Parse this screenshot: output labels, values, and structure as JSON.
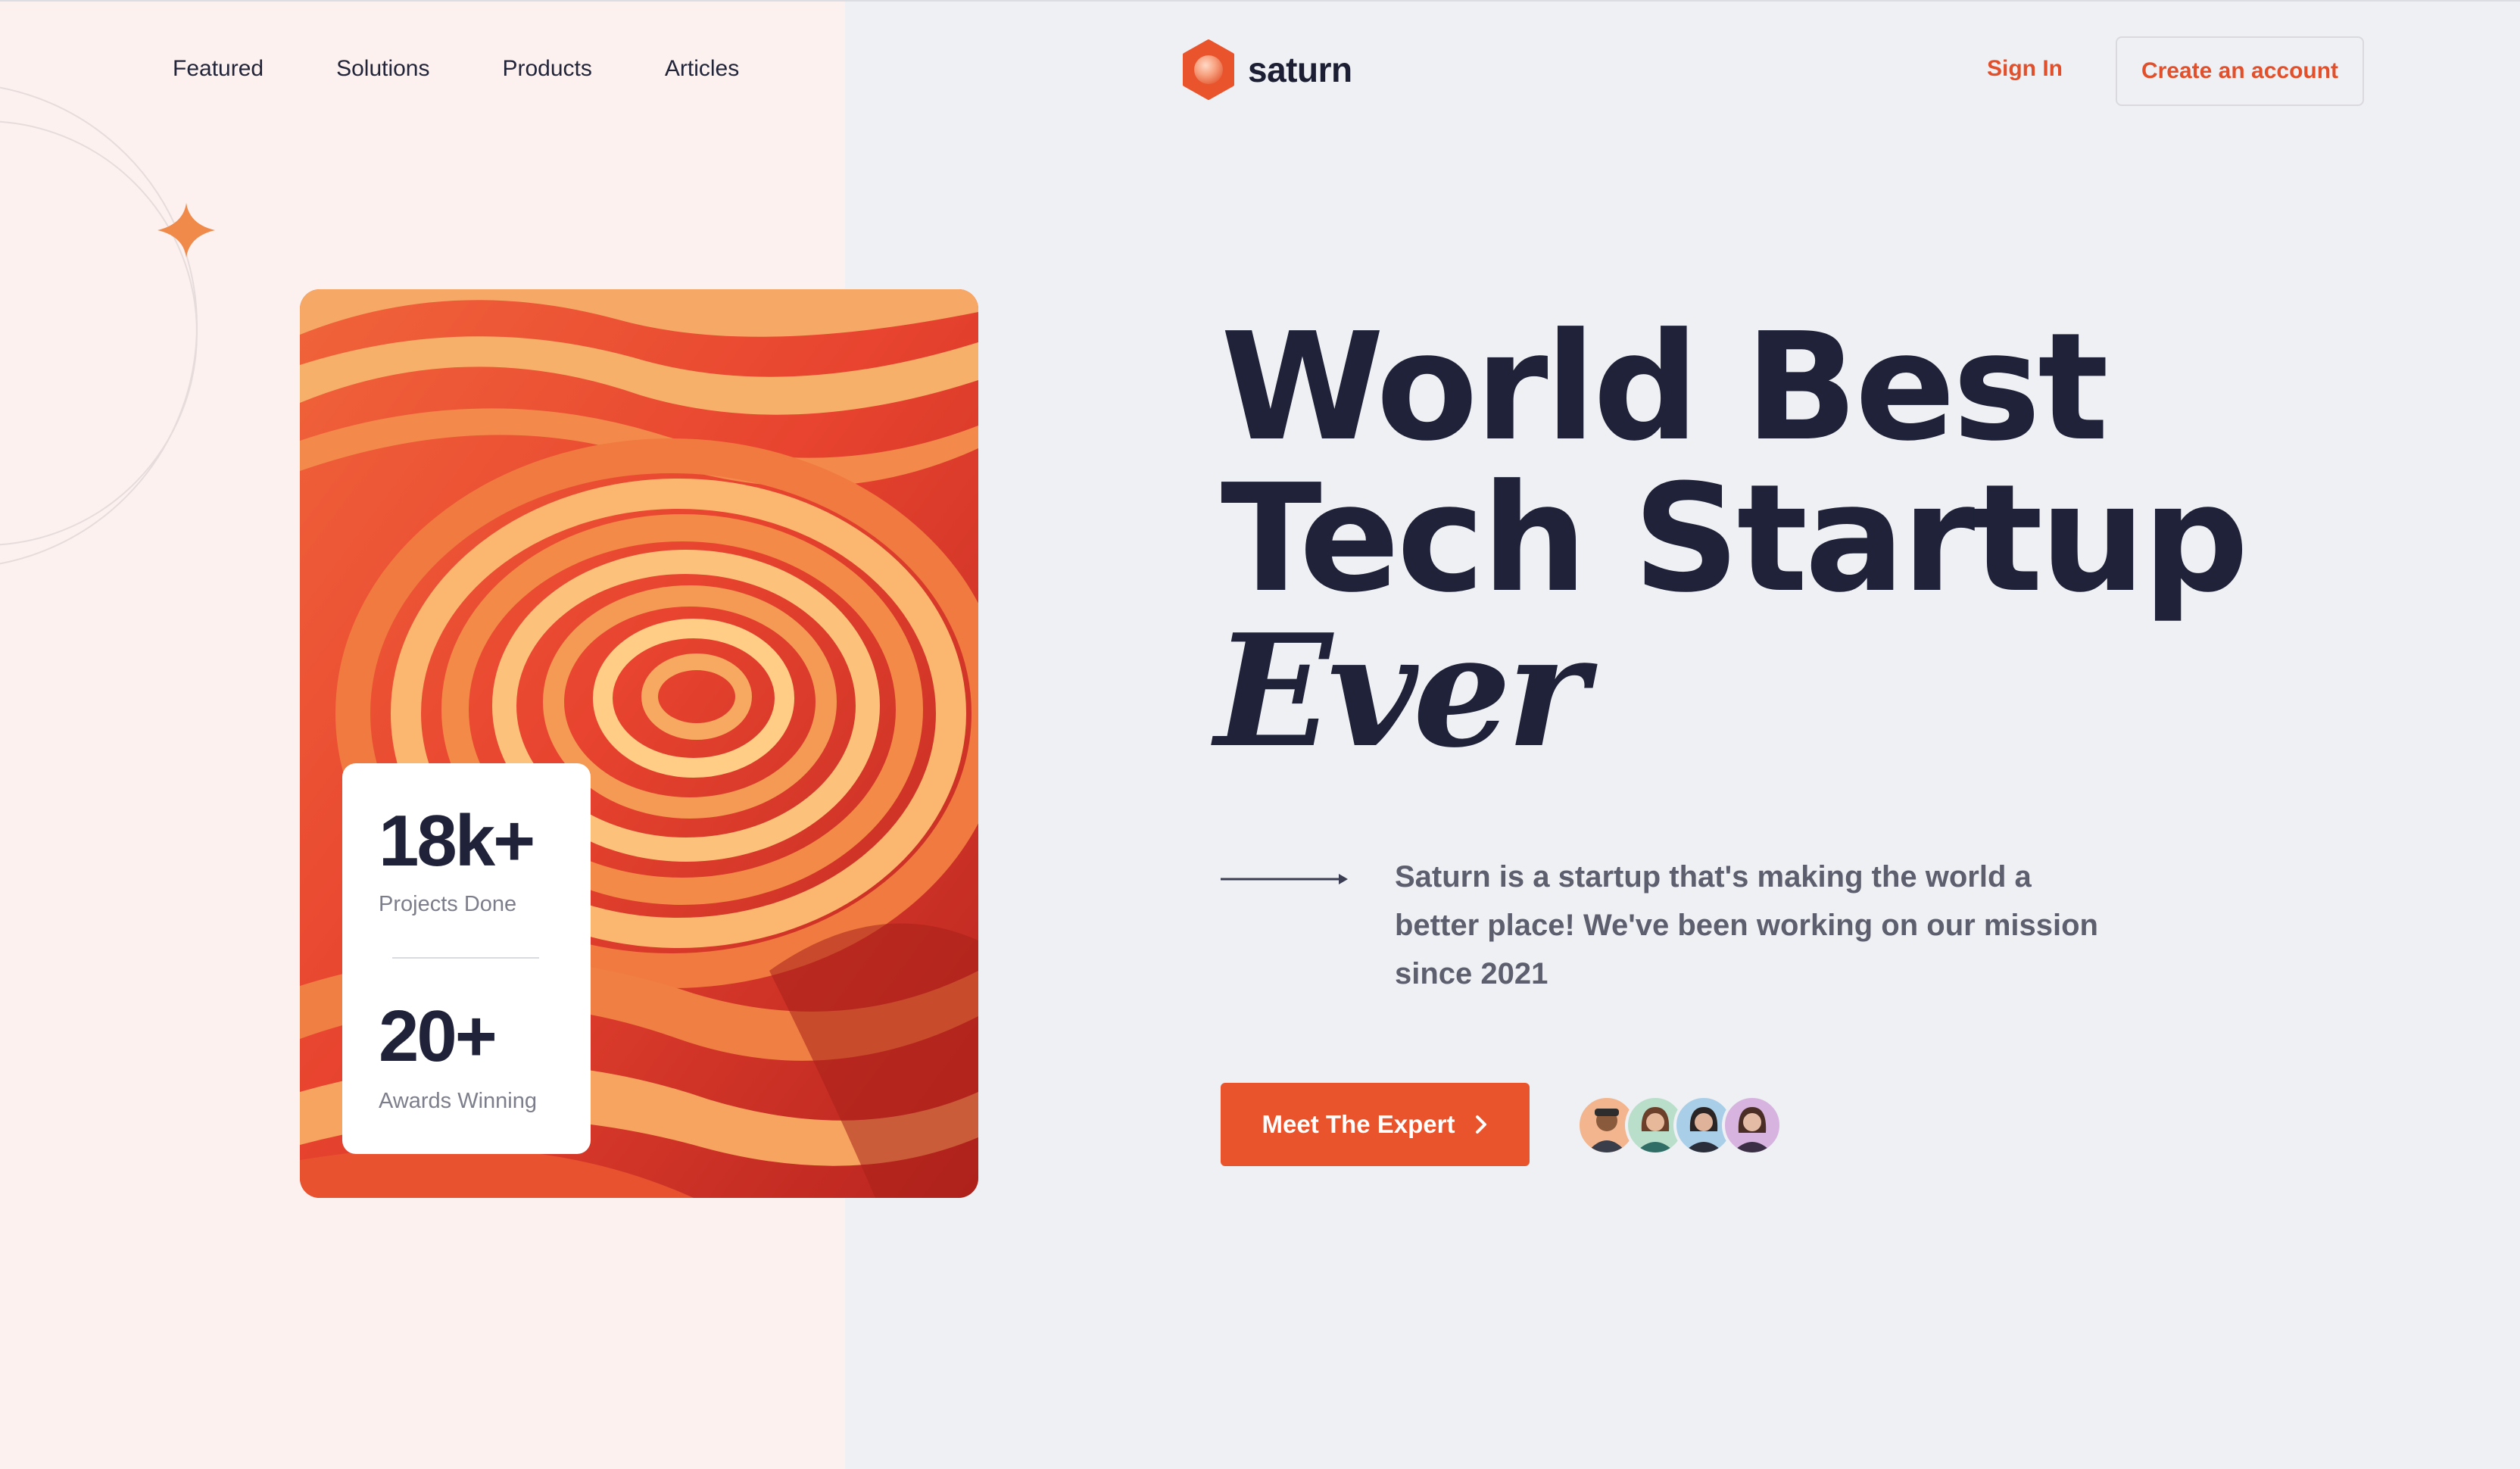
{
  "nav": {
    "items": [
      {
        "label": "Featured"
      },
      {
        "label": "Solutions"
      },
      {
        "label": "Products"
      },
      {
        "label": "Articles"
      }
    ]
  },
  "brand": {
    "name": "saturn",
    "logo_icon": "hexagon-planet-icon",
    "accent": "#e9542c"
  },
  "auth": {
    "sign_in": "Sign In",
    "create_account": "Create an account"
  },
  "hero": {
    "headline_line1": "World Best",
    "headline_line2": "Tech Startup",
    "headline_line3": "Ever",
    "description": "Saturn is a startup that's making the world a better place! We've been working on our mission since 2021",
    "cta_label": "Meet The Expert",
    "cta_icon": "chevron-right-icon",
    "arrow_icon": "arrow-right-icon"
  },
  "stats": [
    {
      "value": "18k+",
      "label": "Projects Done"
    },
    {
      "value": "20+",
      "label": "Awards Winning"
    }
  ],
  "avatars": [
    {
      "name": "avatar-1",
      "bg": "#f2b58d"
    },
    {
      "name": "avatar-2",
      "bg": "#b9dfcb"
    },
    {
      "name": "avatar-3",
      "bg": "#a9cfe8"
    },
    {
      "name": "avatar-4",
      "bg": "#d7b4e0"
    }
  ],
  "colors": {
    "left_panel": "#fcf1ef",
    "right_panel": "#eff0f4",
    "text_dark": "#1f2238",
    "accent": "#e9542c"
  }
}
